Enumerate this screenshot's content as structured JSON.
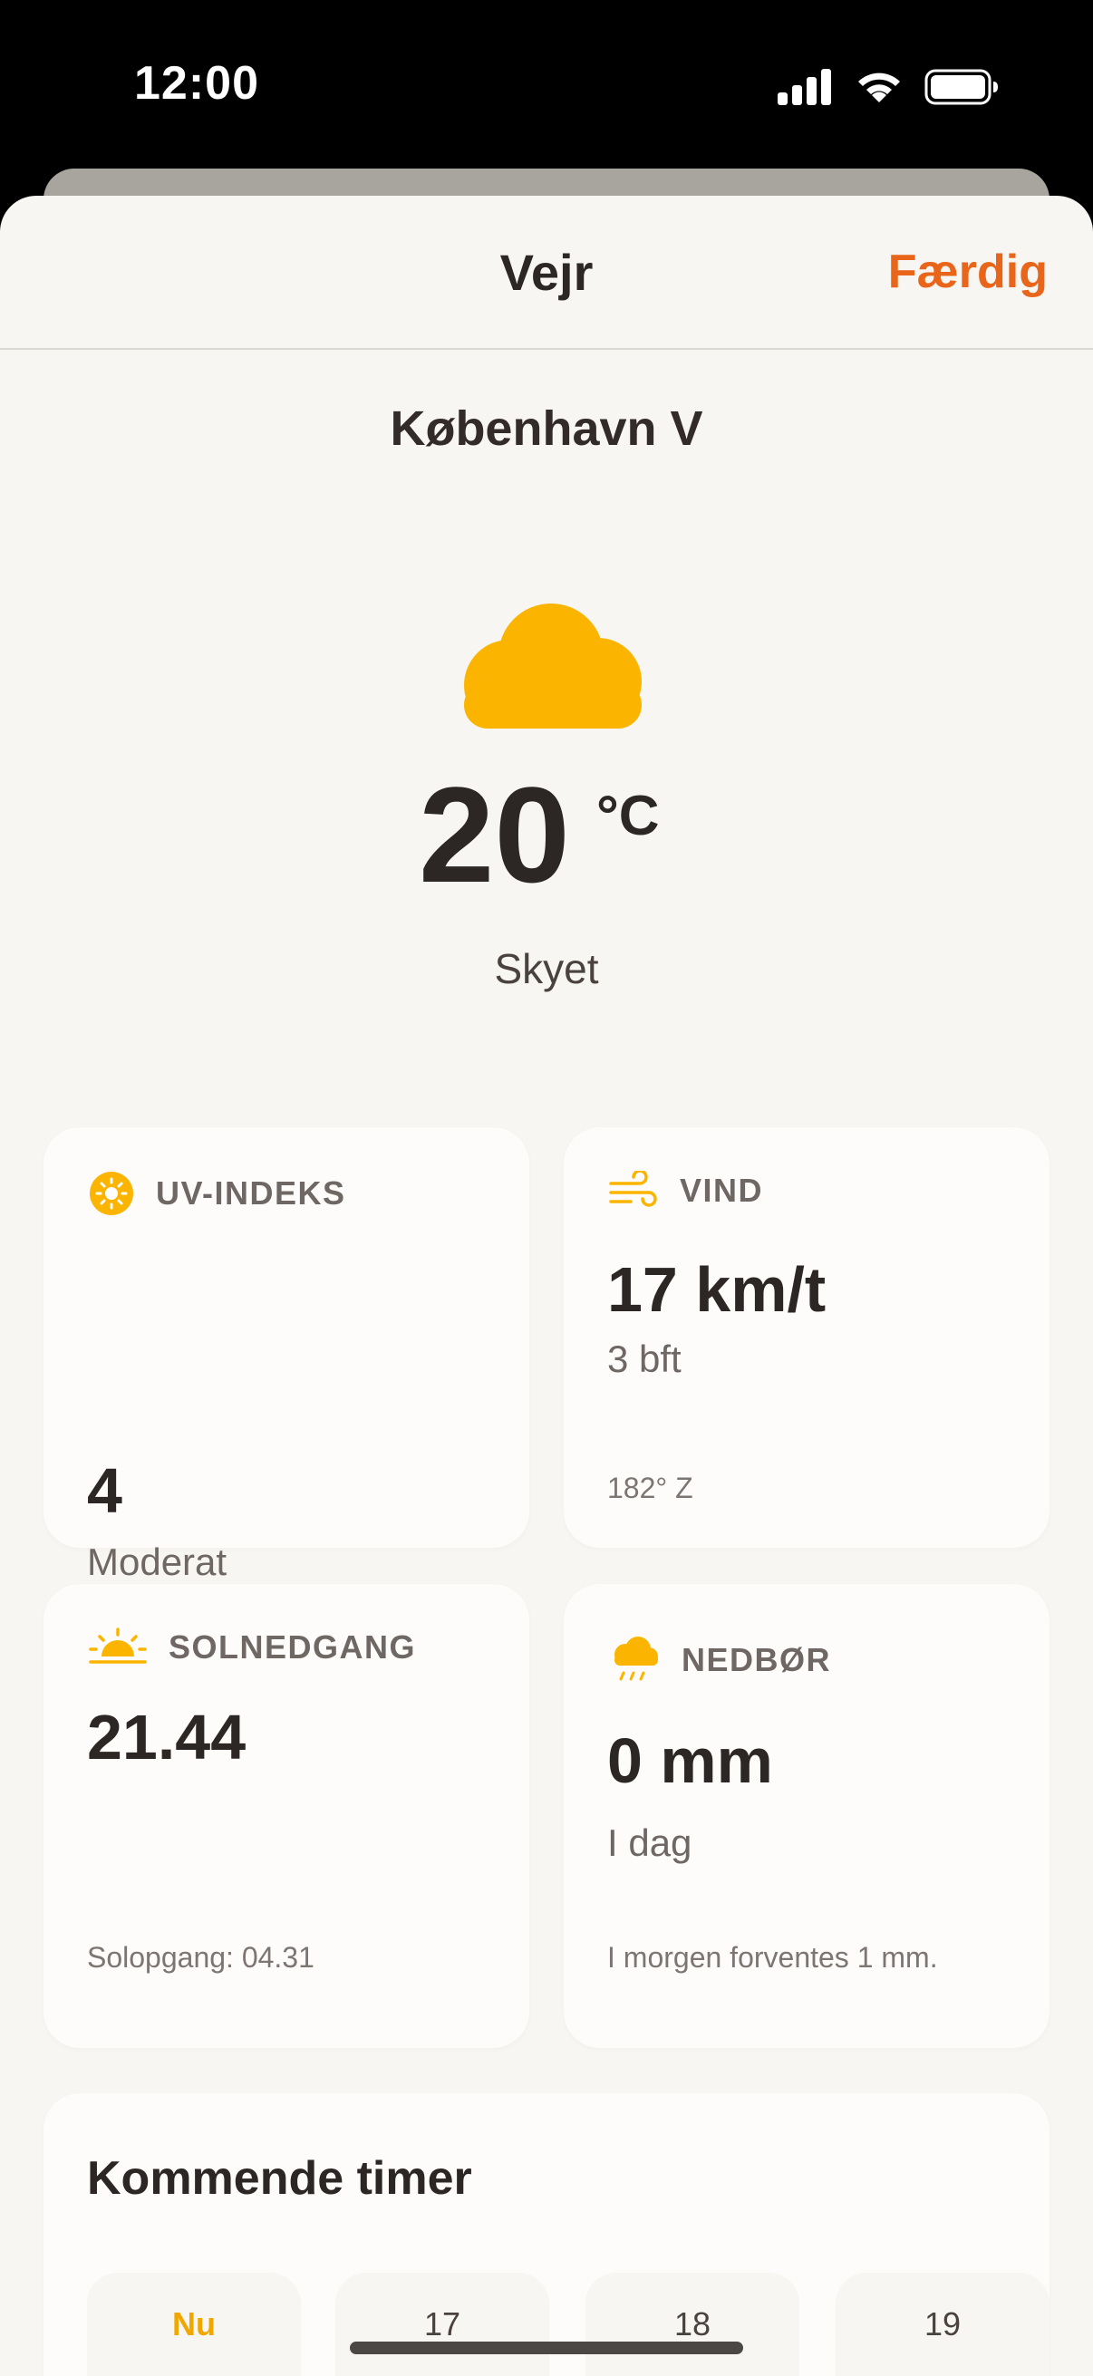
{
  "status_bar": {
    "time": "12:00"
  },
  "nav": {
    "title": "Vejr",
    "done_label": "Færdig"
  },
  "weather": {
    "location": "København V",
    "temperature": "20",
    "unit": "°C",
    "condition": "Skyet",
    "icon": "cloud-icon"
  },
  "cards": {
    "uv": {
      "label": "UV-INDEKS",
      "value": "4",
      "sub": "Moderat",
      "icon": "sun-icon"
    },
    "wind": {
      "label": "VIND",
      "value": "17 km/t",
      "sub": "3 bft",
      "foot": "182° Z",
      "icon": "wind-icon"
    },
    "sunset": {
      "label": "SOLNEDGANG",
      "value": "21.44",
      "foot": "Solopgang: 04.31",
      "icon": "sunset-icon"
    },
    "precip": {
      "label": "NEDBØR",
      "value": "0 mm",
      "sub": "I dag",
      "foot": "I morgen forventes 1 mm.",
      "icon": "rain-cloud-icon"
    }
  },
  "hourly": {
    "title": "Kommende timer",
    "hours": [
      {
        "label": "Nu"
      },
      {
        "label": "17"
      },
      {
        "label": "18"
      },
      {
        "label": "19"
      }
    ]
  },
  "colors": {
    "accent": "#e8651a",
    "icon_yellow": "#fbb500",
    "background": "#f8f6f3",
    "card": "#fdfcfa",
    "text": "#2c2624"
  }
}
